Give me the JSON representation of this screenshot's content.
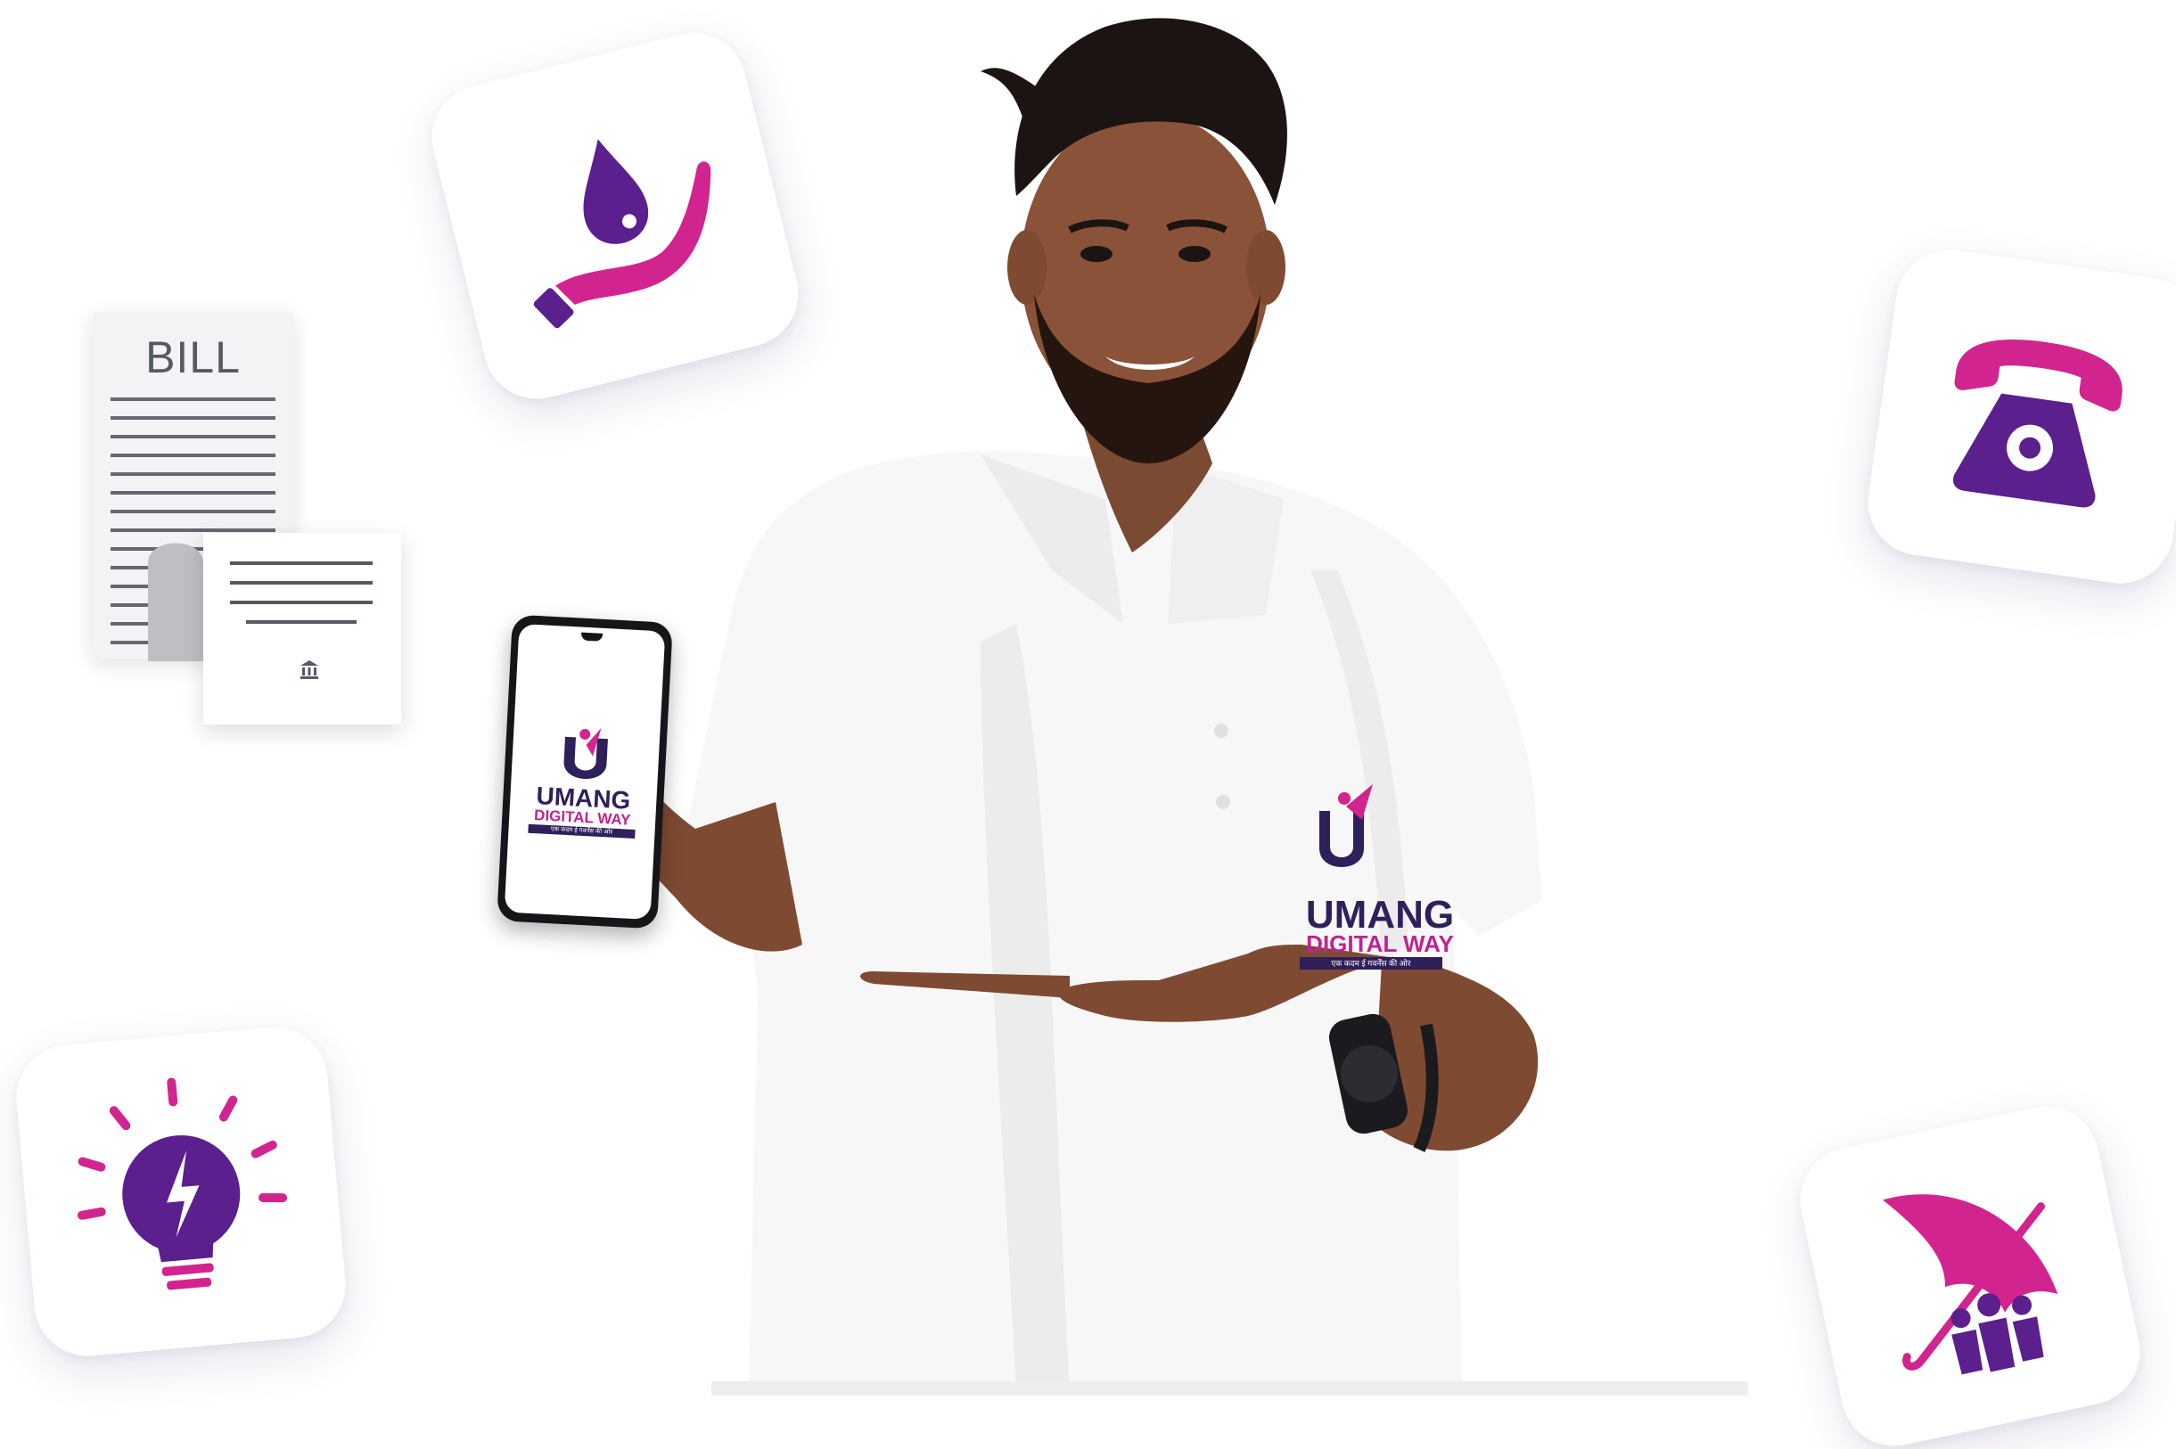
{
  "colors": {
    "accent_purple": "#5b1f8e",
    "accent_magenta": "#d2248f",
    "logo_navy": "#2f1f5a",
    "doc_grey": "#555a63"
  },
  "bill_document": {
    "title": "BILL",
    "icon": "bank-icon"
  },
  "service_tiles": [
    {
      "icon": "water-drop-hand-icon"
    },
    {
      "icon": "telephone-icon"
    },
    {
      "icon": "lightbulb-bolt-icon"
    },
    {
      "icon": "umbrella-family-icon"
    }
  ],
  "brand": {
    "name": "UMANG",
    "subtitle": "DIGITAL WAY",
    "tagline": "एक कदम ई गवर्नेंस की ओर"
  }
}
